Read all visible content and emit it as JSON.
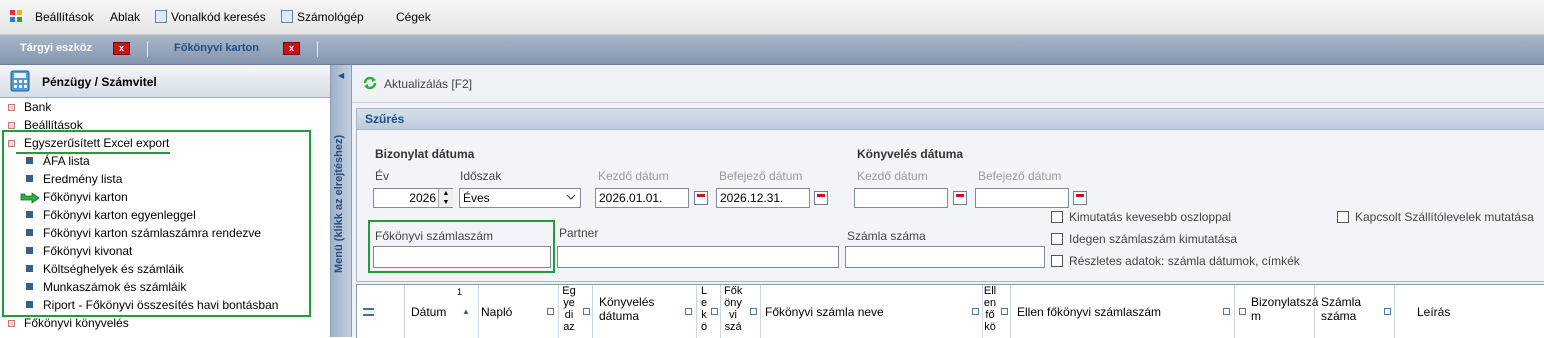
{
  "menu": {
    "items": [
      "Beállítások",
      "Ablak",
      "Vonalkód keresés",
      "Számológép",
      "Cégek"
    ]
  },
  "tabs": [
    {
      "label": "Tárgyi eszköz",
      "close": "x"
    },
    {
      "label": "Főkönyvi karton",
      "close": "x"
    }
  ],
  "left_panel": {
    "title": "Pénzügy / Számvitel",
    "collapse_text": "Menü (klikk az elrejtéshez)",
    "items": [
      {
        "label": "Bank",
        "level": 0
      },
      {
        "label": "Beállítások",
        "level": 0
      },
      {
        "label": "Egyszerűsített Excel export",
        "level": 0
      },
      {
        "label": "ÁFA lista",
        "level": 1
      },
      {
        "label": "Eredmény lista",
        "level": 1
      },
      {
        "label": "Főkönyvi karton",
        "level": 1,
        "active": true
      },
      {
        "label": "Főkönyvi karton egyenleggel",
        "level": 1
      },
      {
        "label": "Főkönyvi karton számlaszámra rendezve",
        "level": 1
      },
      {
        "label": "Főkönyvi kivonat",
        "level": 1
      },
      {
        "label": "Költséghelyek és számláik",
        "level": 1
      },
      {
        "label": "Munkaszámok és számláik",
        "level": 1
      },
      {
        "label": "Riport - Főkönyvi összesítés havi bontásban",
        "level": 1
      },
      {
        "label": "Főkönyvi könyvelés",
        "level": 0
      }
    ]
  },
  "toolbar": {
    "refresh_label": "Aktualizálás [F2]"
  },
  "filter": {
    "title": "Szűrés",
    "doc_date_heading": "Bizonylat dátuma",
    "book_date_heading": "Könyvelés dátuma",
    "year_label": "Év",
    "year_value": "2026",
    "period_label": "Időszak",
    "period_value": "Éves",
    "start_label": "Kezdő dátum",
    "end_label": "Befejező dátum",
    "start_value": "2026.01.01.",
    "end_value": "2026.12.31.",
    "book_start_label": "Kezdő dátum",
    "book_end_label": "Befejező dátum",
    "account_label": "Főkönyvi számlaszám",
    "partner_label": "Partner",
    "invoice_label": "Számla száma",
    "checkboxes": [
      "Kimutatás kevesebb oszloppal",
      "Idegen számlaszám kimutatása",
      "Részletes adatok: számla dátumok, címkék"
    ],
    "linked_checkbox": "Kapcsolt Szállítólevelek mutatása"
  },
  "grid": {
    "sort_index": "1",
    "columns": {
      "datum": "Dátum",
      "naplo": "Napló",
      "egyedi": [
        "Eg",
        "ye",
        "di",
        "az"
      ],
      "konyv_datum": [
        "Könyvelés",
        "dátuma"
      ],
      "lekot": [
        "L",
        "e",
        "k",
        "ö"
      ],
      "fokonyvi": [
        "Fők",
        "öny",
        "vi",
        "szá"
      ],
      "fokonyvi_neve": "Főkönyvi számla neve",
      "ellen": [
        "Ell",
        "en",
        "fő",
        "kö"
      ],
      "ellen_szam": "Ellen főkönyvi számlaszám",
      "bizonylat": [
        "Bizonylatszá",
        "m"
      ],
      "szamla": [
        "Számla",
        "száma"
      ],
      "leiras": "Leírás"
    }
  }
}
